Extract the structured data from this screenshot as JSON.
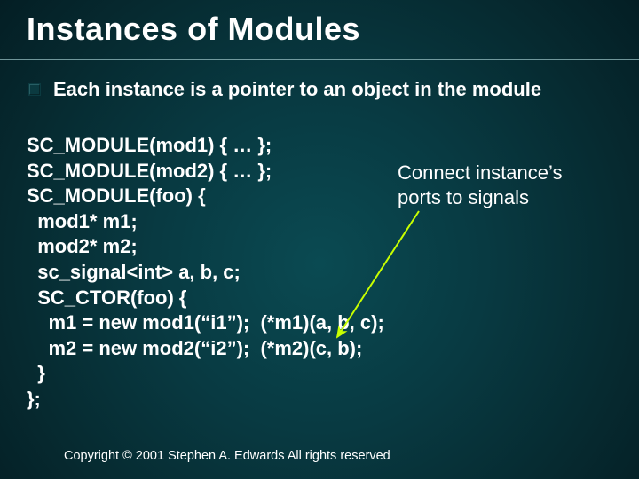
{
  "title": "Instances of Modules",
  "bullet": "Each instance is a pointer to an object in the module",
  "code": "SC_MODULE(mod1) { … };\nSC_MODULE(mod2) { … };\nSC_MODULE(foo) {\n  mod1* m1;\n  mod2* m2;\n  sc_signal<int> a, b, c;\n  SC_CTOR(foo) {\n    m1 = new mod1(“i1”);  (*m1)(a, b, c);\n    m2 = new mod2(“i2”);  (*m2)(c, b);\n  }\n};",
  "annotation_line1": "Connect instance’s",
  "annotation_line2": "ports to signals",
  "copyright": "Copyright © 2001 Stephen A. Edwards  All rights reserved",
  "colors": {
    "arrow": "#c8ff00"
  }
}
